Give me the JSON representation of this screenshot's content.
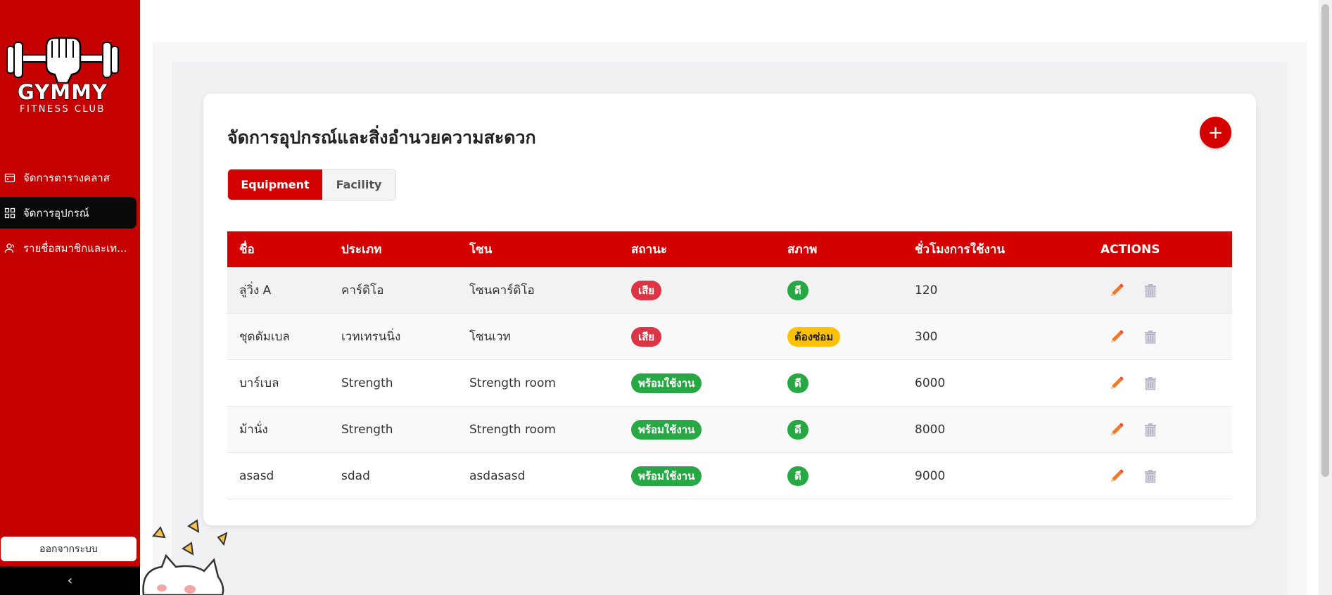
{
  "brand": {
    "name": "GYMMY",
    "subtitle": "FITNESS CLUB"
  },
  "sidebar": {
    "items": [
      {
        "label": "จัดการตารางคลาส",
        "icon": "calendar-icon",
        "active": false
      },
      {
        "label": "จัดการอุปกรณ์",
        "icon": "grid-icon",
        "active": true
      },
      {
        "label": "รายชื่อสมาชิกและเท...",
        "icon": "users-icon",
        "active": false
      }
    ],
    "logout_label": "ออกจากระบบ",
    "collapse_label": "‹"
  },
  "main": {
    "title": "จัดการอุปกรณ์และสิ่งอำนวยความสะดวก",
    "add_label": "+",
    "tabs": [
      {
        "label": "Equipment",
        "active": true
      },
      {
        "label": "Facility",
        "active": false
      }
    ]
  },
  "table": {
    "headers": [
      "ชื่อ",
      "ประเภท",
      "โซน",
      "สถานะ",
      "สภาพ",
      "ชั่วโมงการใช้งาน",
      "ACTIONS"
    ],
    "rows": [
      {
        "name": "ลู่วิ่ง A",
        "type": "คาร์ดิโอ",
        "zone": "โซนคาร์ดิโอ",
        "status": "เสีย",
        "status_color": "#dc3545",
        "condition": "ดี",
        "condition_color": "#28a745",
        "hours": "120"
      },
      {
        "name": "ชุดดัมเบล",
        "type": "เวทเทรนนิ่ง",
        "zone": "โซนเวท",
        "status": "เสีย",
        "status_color": "#dc3545",
        "condition": "ต้องซ่อม",
        "condition_color": "#ffc107",
        "hours": "300"
      },
      {
        "name": "บาร์เบล",
        "type": "Strength",
        "zone": "Strength room",
        "status": "พร้อมใช้งาน",
        "status_color": "#28a745",
        "condition": "ดี",
        "condition_color": "#28a745",
        "hours": "6000"
      },
      {
        "name": "ม้านั่ง",
        "type": "Strength",
        "zone": "Strength room",
        "status": "พร้อมใช้งาน",
        "status_color": "#28a745",
        "condition": "ดี",
        "condition_color": "#28a745",
        "hours": "8000"
      },
      {
        "name": "asasd",
        "type": "sdad",
        "zone": "asdasasd",
        "status": "พร้อมใช้งาน",
        "status_color": "#28a745",
        "condition": "ดี",
        "condition_color": "#28a745",
        "hours": "9000"
      }
    ],
    "row_action_icons": [
      "pencil-icon",
      "trash-icon"
    ]
  },
  "colors": {
    "primary": "#d40000",
    "sidebar": "#c40000",
    "active_nav": "#0a0a0a"
  }
}
